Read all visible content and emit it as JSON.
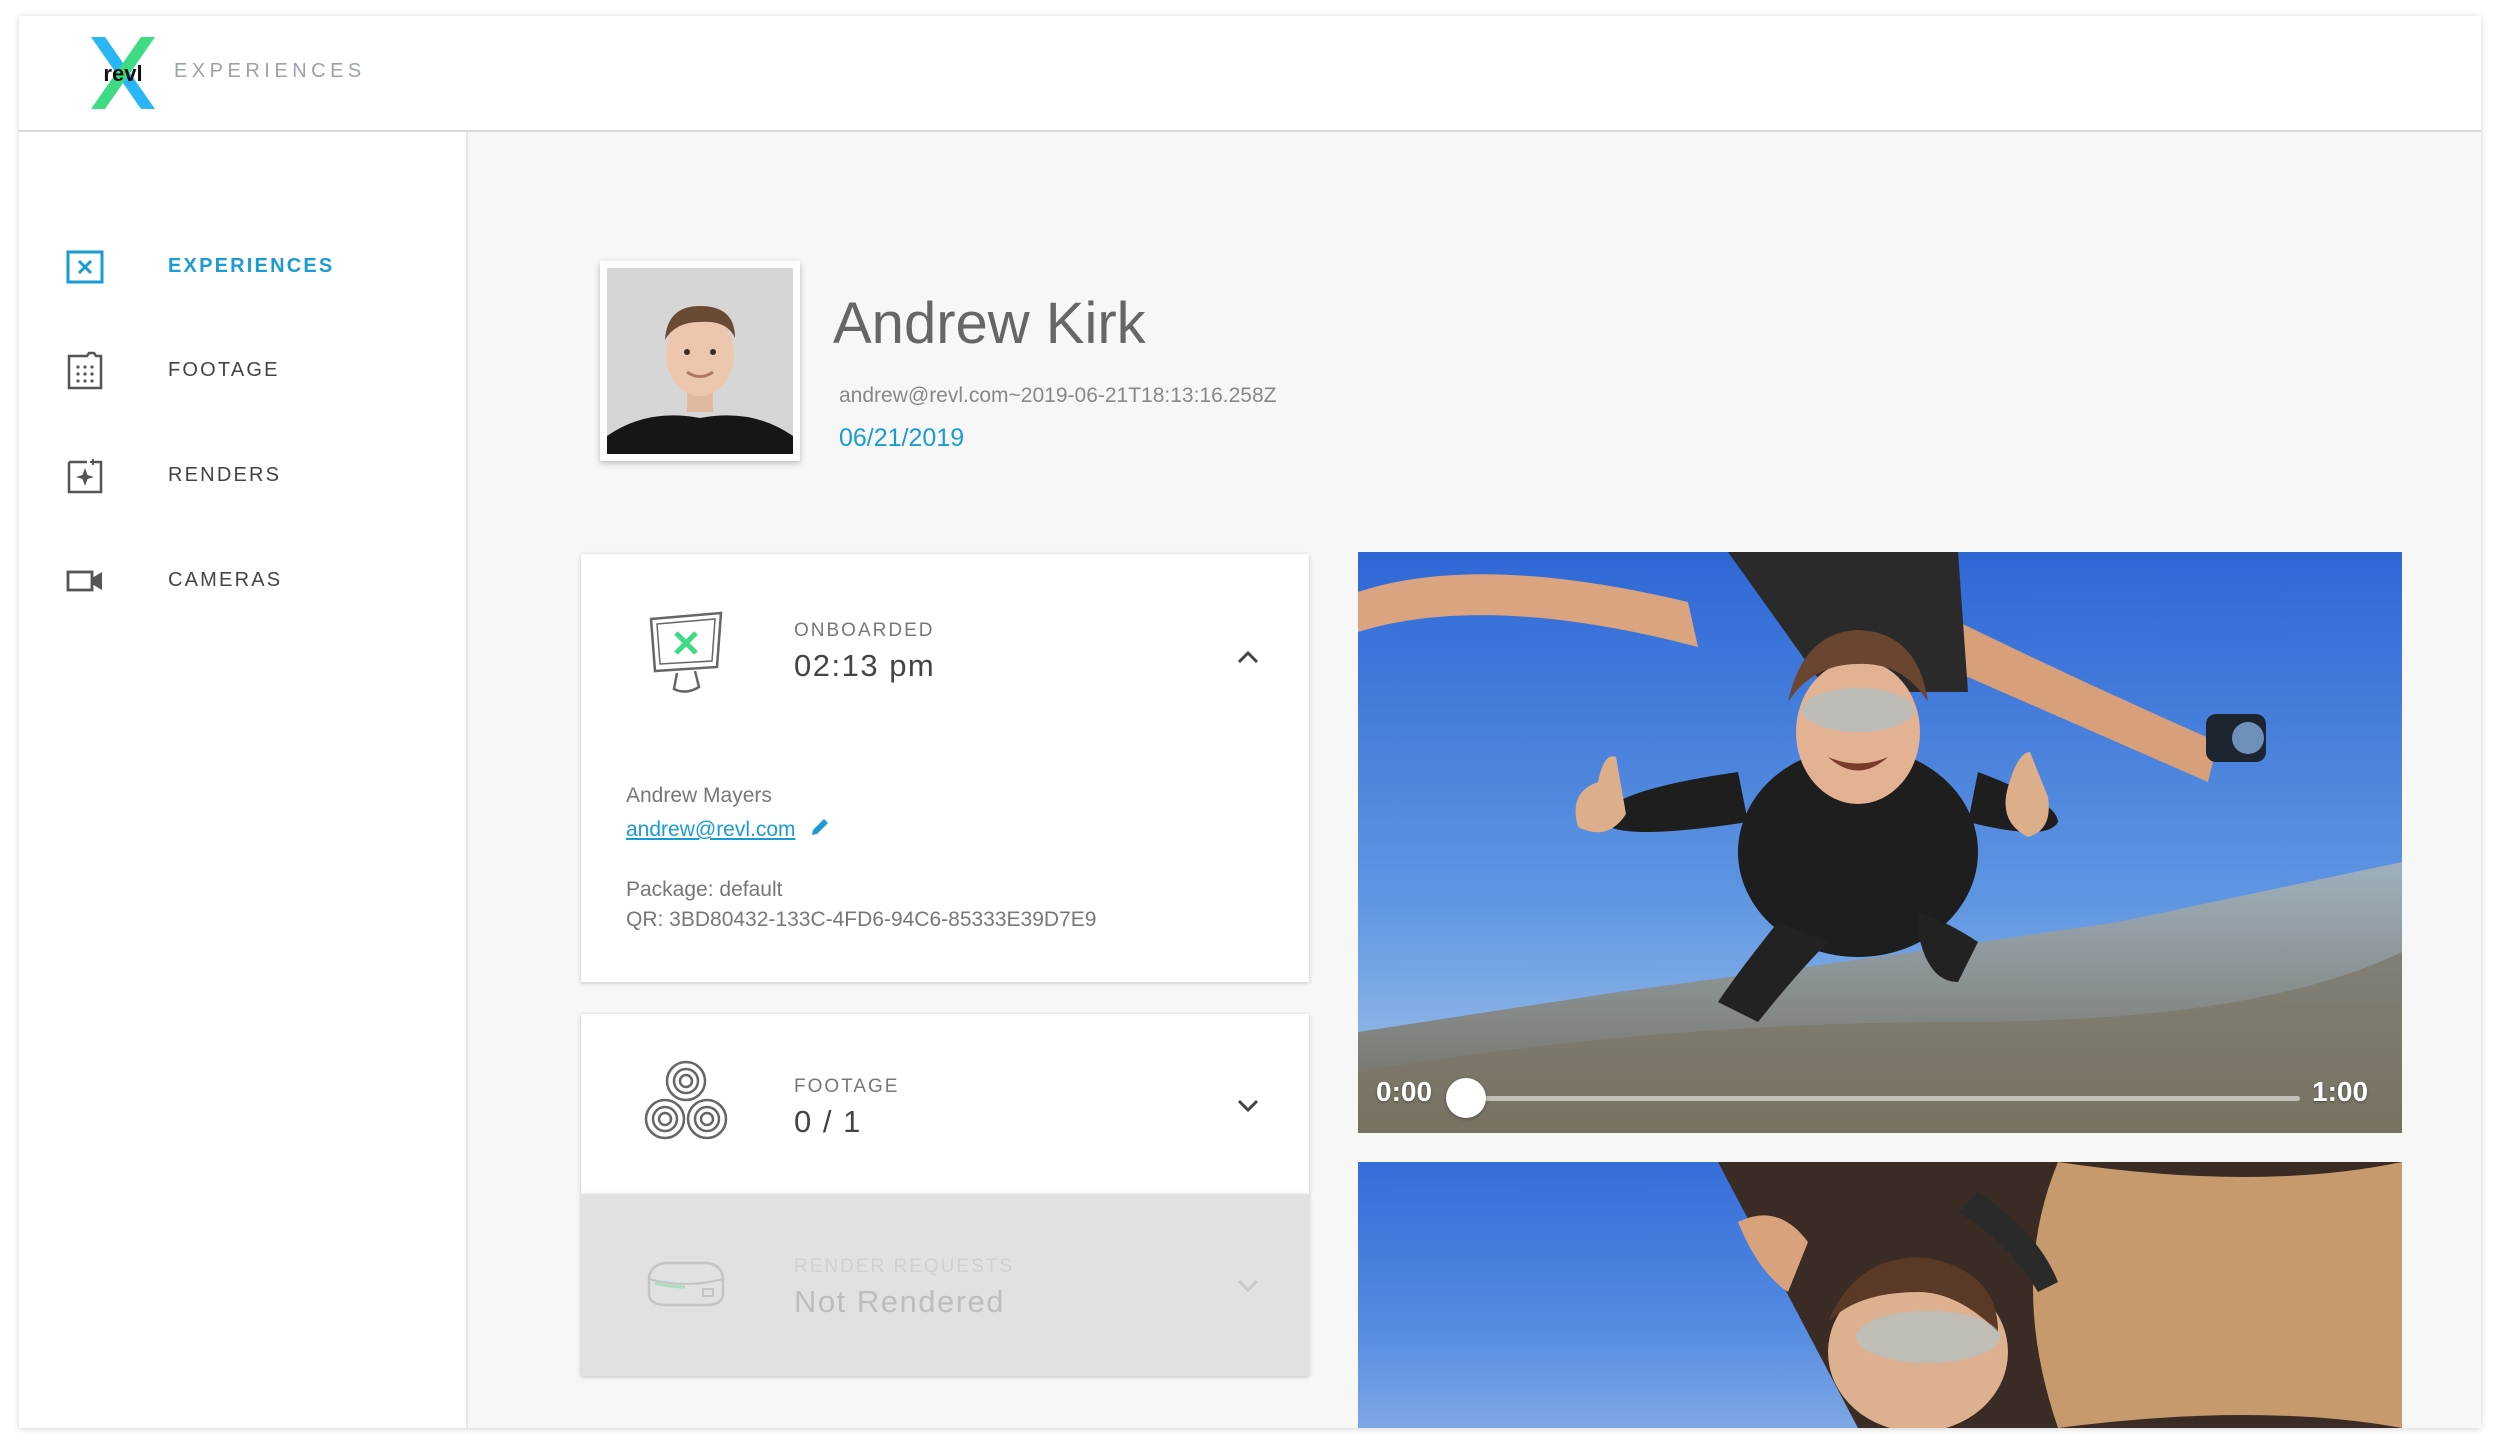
{
  "header": {
    "title": "EXPERIENCES",
    "logo_text": "revl"
  },
  "sidebar": {
    "items": [
      {
        "label": "EXPERIENCES",
        "icon": "experiences-icon",
        "active": true
      },
      {
        "label": "FOOTAGE",
        "icon": "footage-icon",
        "active": false
      },
      {
        "label": "RENDERS",
        "icon": "renders-icon",
        "active": false
      },
      {
        "label": "CAMERAS",
        "icon": "camera-icon",
        "active": false
      }
    ]
  },
  "person": {
    "name": "Andrew Kirk",
    "id": "andrew@revl.com~2019-06-21T18:13:16.258Z",
    "date": "06/21/2019"
  },
  "cards": {
    "onboarded": {
      "label": "ONBOARDED",
      "value": "02:13 pm",
      "contact_name": "Andrew Mayers",
      "email": "andrew@revl.com",
      "package": "Package: default",
      "qr": "QR: 3BD80432-133C-4FD6-94C6-85333E39D7E9"
    },
    "footage": {
      "label": "FOOTAGE",
      "value": "0 / 1"
    },
    "render_requests": {
      "label": "RENDER REQUESTS",
      "value": "Not Rendered"
    }
  },
  "video": {
    "current_time": "0:00",
    "duration": "1:00",
    "progress": 0
  },
  "colors": {
    "accent": "#1a9cd3",
    "logo_green": "#3ddc84",
    "logo_blue": "#29b6f6"
  }
}
